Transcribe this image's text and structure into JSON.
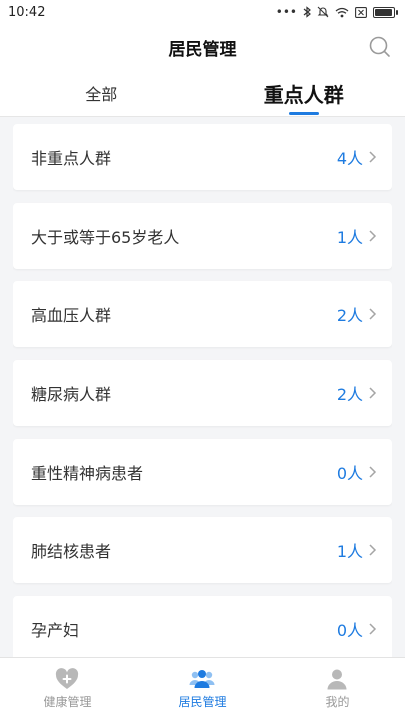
{
  "status_bar": {
    "time": "10:42"
  },
  "header": {
    "title": "居民管理"
  },
  "tabs": [
    {
      "label": "全部",
      "active": false
    },
    {
      "label": "重点人群",
      "active": true
    }
  ],
  "groups": [
    {
      "label": "非重点人群",
      "count": "4人"
    },
    {
      "label": "大于或等于65岁老人",
      "count": "1人"
    },
    {
      "label": "高血压人群",
      "count": "2人"
    },
    {
      "label": "糖尿病人群",
      "count": "2人"
    },
    {
      "label": "重性精神病患者",
      "count": "0人"
    },
    {
      "label": "肺结核患者",
      "count": "1人"
    },
    {
      "label": "孕产妇",
      "count": "0人"
    }
  ],
  "bottom_nav": [
    {
      "label": "健康管理",
      "icon": "health-heart-icon",
      "active": false
    },
    {
      "label": "居民管理",
      "icon": "residents-icon",
      "active": true
    },
    {
      "label": "我的",
      "icon": "profile-icon",
      "active": false
    }
  ],
  "colors": {
    "accent": "#1e7be0",
    "inactive": "#b8b8b8",
    "background": "#f4f5f7"
  }
}
